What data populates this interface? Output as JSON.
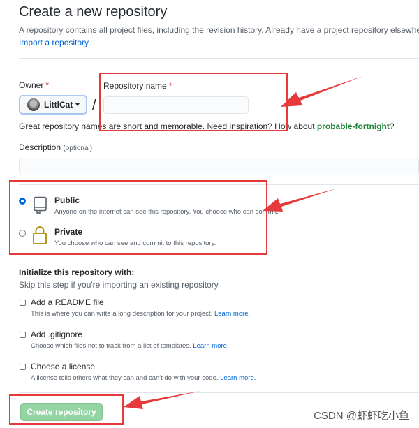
{
  "page": {
    "title": "Create a new repository",
    "intro": "A repository contains all project files, including the revision history. Already have a project repository elsewhere?",
    "import_link": "Import a repository."
  },
  "owner": {
    "label": "Owner",
    "required_mark": "*",
    "name": "LittlCat"
  },
  "separator": "/",
  "repo_name": {
    "label": "Repository name",
    "required_mark": "*",
    "value": ""
  },
  "name_hint": {
    "text": "Great repository names are short and memorable. Need inspiration? How about ",
    "suggestion": "probable-fortnight",
    "suffix": "?"
  },
  "description": {
    "label": "Description",
    "optional": "(optional)",
    "value": ""
  },
  "visibility": {
    "selected": "Public",
    "options": [
      {
        "title": "Public",
        "desc": "Anyone on the internet can see this repository. You choose who can commit.",
        "icon": "repo-icon"
      },
      {
        "title": "Private",
        "desc": "You choose who can see and commit to this repository.",
        "icon": "lock-icon"
      }
    ]
  },
  "init": {
    "title": "Initialize this repository with:",
    "subtitle": "Skip this step if you're importing an existing repository.",
    "options": [
      {
        "title": "Add a README file",
        "desc": "This is where you can write a long description for your project.",
        "link": "Learn more."
      },
      {
        "title": "Add .gitignore",
        "desc": "Choose which files not to track from a list of templates.",
        "link": "Learn more."
      },
      {
        "title": "Choose a license",
        "desc": "A license tells others what they can and can't do with your code.",
        "link": "Learn more."
      }
    ]
  },
  "submit": {
    "label": "Create repository"
  },
  "watermark": "CSDN @虾虾吃小鱼",
  "colors": {
    "annotation": "#e5393b",
    "accent": "#0366d6",
    "suggest": "#22863a",
    "button": "#94d3a2"
  }
}
